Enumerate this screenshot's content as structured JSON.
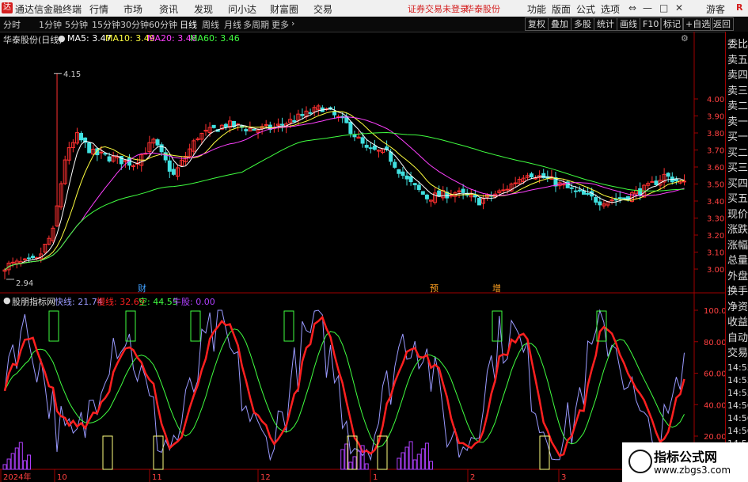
{
  "menubar": {
    "app_title": "通达信金融终端",
    "menus": [
      "行情",
      "市场",
      "资讯",
      "发现",
      "问小达",
      "财富圈",
      "交易"
    ],
    "broker_status": "证券交易未登录",
    "stock_status": "华泰股份",
    "right_menus": [
      "功能",
      "版面",
      "公式",
      "选项"
    ],
    "window_buttons": [
      "⇔",
      "—",
      "□",
      "✕"
    ],
    "guest": "游客",
    "badge": "R"
  },
  "toolbar": {
    "periods": [
      "分时",
      "1分钟",
      "5分钟",
      "15分钟",
      "30分钟",
      "60分钟",
      "日线",
      "周线",
      "月线",
      "多周期",
      "更多"
    ],
    "active_period": "日线",
    "right_buttons": [
      "复权",
      "叠加",
      "多股",
      "统计",
      "画线",
      "F10",
      "标记",
      "+自选",
      "返回"
    ]
  },
  "price_chart": {
    "title": "华泰股份(日线)",
    "ma5": "MA5: 3.47",
    "ma10": "MA10: 3.49",
    "ma20": "MA20: 3.46",
    "ma60": "MA60: 3.46",
    "high_label": "4.15",
    "low_label": "2.94",
    "axis_labels": [
      "4.00",
      "3.90",
      "3.80",
      "3.70",
      "3.60",
      "3.50",
      "3.40",
      "3.30",
      "3.20",
      "3.10",
      "3.00"
    ],
    "event_markers": [
      "财",
      "预",
      "增"
    ],
    "colors": {
      "up": "#ff3030",
      "down": "#40e0e0",
      "ma5": "#ffffff",
      "ma10": "#ffff40",
      "ma20": "#ff40ff",
      "ma60": "#40ff40"
    }
  },
  "indicator": {
    "name": "股朋指标网",
    "fast": "快线: 21.74",
    "slow": "慢线: 32.69",
    "empty": "空: 44.55",
    "bull": "牛股: 0.00",
    "axis_labels": [
      "100.0",
      "80.00",
      "60.00",
      "40.00",
      "20.00"
    ],
    "colors": {
      "fast": "#9a9aff",
      "slow": "#ff2020",
      "signal": "#40ff40",
      "bars": "#b040ff"
    }
  },
  "x_axis": {
    "labels": [
      "2024年",
      "10",
      "11",
      "12",
      "1",
      "2",
      "3"
    ]
  },
  "right_panel": {
    "items": [
      "委比",
      "卖五",
      "卖四",
      "卖三",
      "卖二",
      "卖一",
      "买一",
      "买二",
      "买三",
      "买四",
      "买五",
      "现价",
      "涨跌",
      "涨幅",
      "总量",
      "外盘",
      "换手",
      "净资",
      "收益",
      "自动",
      "交易"
    ],
    "times": [
      "14:55",
      "14:55",
      "14:55",
      "14:56",
      "14:56",
      "14:56",
      "14:56",
      "14:56"
    ]
  },
  "watermark": {
    "title": "指标公式网",
    "url": "www.zbgs3.com"
  }
}
